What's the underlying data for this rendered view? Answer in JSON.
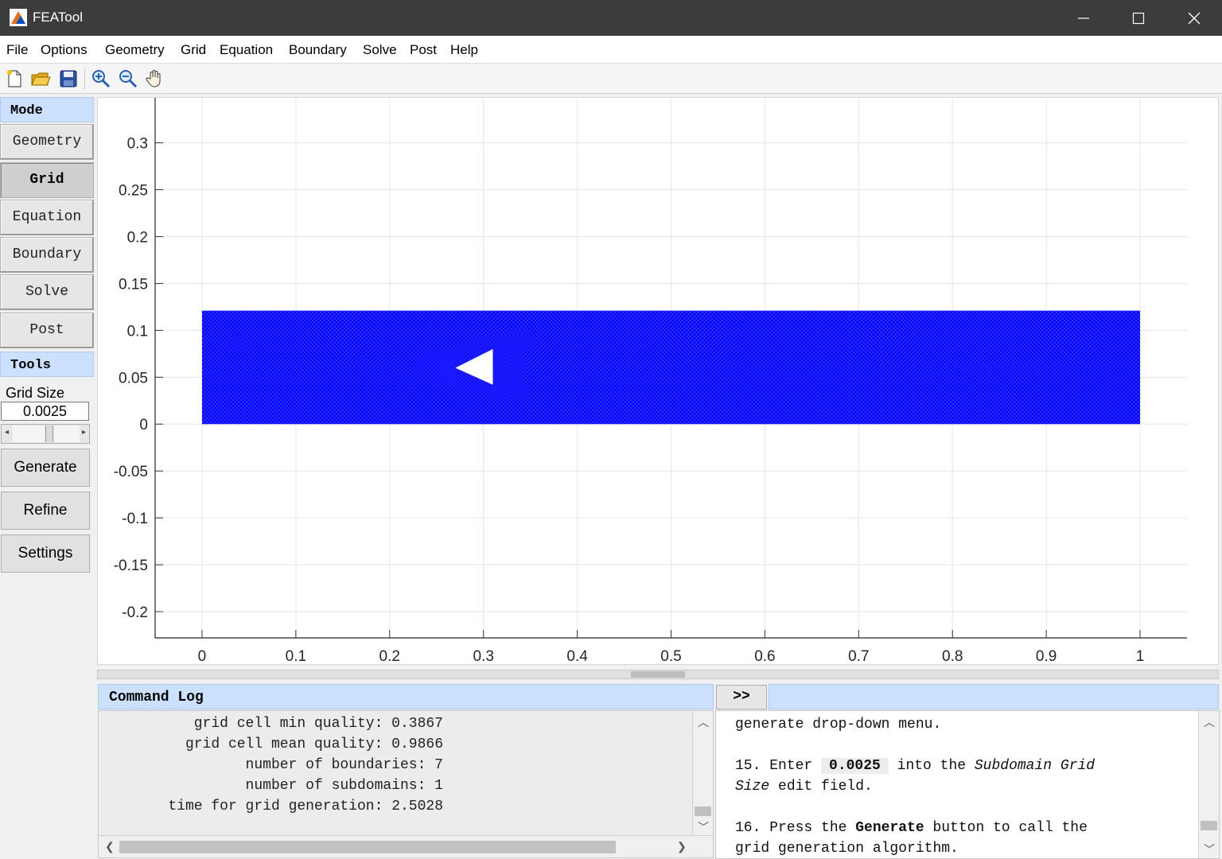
{
  "window": {
    "title": "FEATool",
    "minimize": "—",
    "maximize": "☐",
    "close": "✕"
  },
  "menu": [
    "File",
    "Options",
    "Geometry",
    "Grid",
    "Equation",
    "Boundary",
    "Solve",
    "Post",
    "Help"
  ],
  "toolbar": [
    "new-file-icon",
    "open-folder-icon",
    "save-icon",
    "zoom-in-icon",
    "zoom-out-icon",
    "pan-hand-icon"
  ],
  "left_panel": {
    "mode_header": "Mode",
    "modes": [
      "Geometry",
      "Grid",
      "Equation",
      "Boundary",
      "Solve",
      "Post"
    ],
    "active_mode": "Grid",
    "tools_header": "Tools",
    "grid_size_label": "Grid Size",
    "grid_size_value": "0.0025",
    "buttons": [
      "Generate",
      "Refine",
      "Settings"
    ]
  },
  "plot": {
    "x_ticks": [
      "0",
      "0.1",
      "0.2",
      "0.3",
      "0.4",
      "0.5",
      "0.6",
      "0.7",
      "0.8",
      "0.9",
      "1"
    ],
    "y_ticks": [
      "0.3",
      "0.25",
      "0.2",
      "0.15",
      "0.1",
      "0.05",
      "0",
      "-0.05",
      "-0.1",
      "-0.15",
      "-0.2"
    ],
    "xlim": [
      -0.05,
      1.05
    ],
    "ylim": [
      -0.228,
      0.348
    ],
    "mesh_color": "#0000ff",
    "domain": {
      "x0": 0,
      "x1": 1,
      "y0": 0,
      "y1": 0.121
    },
    "obstacle": [
      [
        0.27,
        0.06
      ],
      [
        0.31,
        0.08
      ],
      [
        0.31,
        0.042
      ]
    ]
  },
  "command_log": {
    "title": "Command Log",
    "lines": [
      "grid cell min quality: 0.3867",
      "grid cell mean quality: 0.9866",
      "number of boundaries: 7",
      "number of subdomains: 1",
      "time for grid generation: 2.5028"
    ]
  },
  "help": {
    "toggle_label": ">>",
    "line1": "generate drop-down menu.",
    "step15_prefix": "15. Enter ",
    "step15_value": "0.0025",
    "step15_mid": " into the ",
    "step15_italic": "Subdomain Grid",
    "step15_line2": "Size edit field.",
    "step16_prefix": "16. Press the ",
    "step16_bold": "Generate",
    "step16_suffix": " button to call the",
    "step16_line2": "grid generation algorithm."
  }
}
